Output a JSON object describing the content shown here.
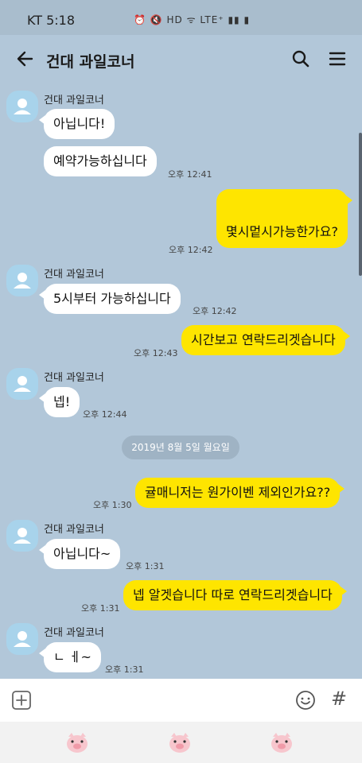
{
  "status_bar": {
    "time": "KT 5:18",
    "icons": [
      "alarm-icon",
      "mute-icon",
      "hd-icon",
      "wifi-icon",
      "lte-icon",
      "signal-icon",
      "battery-icon"
    ],
    "icons_text": "⏰ 🔇 HD ᯤ LTE⁺ ▮▮ ▮"
  },
  "app_bar": {
    "title": "건대 과일코너"
  },
  "chat": {
    "sender": "건대 과일코너",
    "messages": [
      {
        "from": "them",
        "text": "아닙니다!"
      },
      {
        "from": "them",
        "text": "예약가능하십니다",
        "time": "오후 12:41"
      },
      {
        "from": "me",
        "text": "몇시멑시가능한가요?",
        "time": "오후 12:42"
      },
      {
        "from": "them",
        "text": "5시부터 가능하십니다",
        "time": "오후 12:42"
      },
      {
        "from": "me",
        "text": "시간보고 연락드리겟습니다",
        "time": "오후 12:43"
      },
      {
        "from": "them",
        "text": "넵!",
        "time": "오후 12:44"
      },
      {
        "from": "me",
        "text": "귤매니저는  원가이벤 제외인가요??",
        "time": "오후 1:30"
      },
      {
        "from": "them",
        "text": "아닙니다~",
        "time": "오후 1:31"
      },
      {
        "from": "me",
        "text": "넵 알겟습니다 따로 연락드리겟습니다",
        "time": "오후 1:31"
      },
      {
        "from": "them",
        "text": "ㄴ ㅔ~",
        "time": "오후 1:31"
      }
    ],
    "date_divider": "2019년 8월 5일 월요일"
  },
  "colors": {
    "background": "#b2c7d9",
    "outgoing_bubble": "#fee500",
    "incoming_bubble": "#ffffff",
    "avatar": "#a8d3eb"
  }
}
